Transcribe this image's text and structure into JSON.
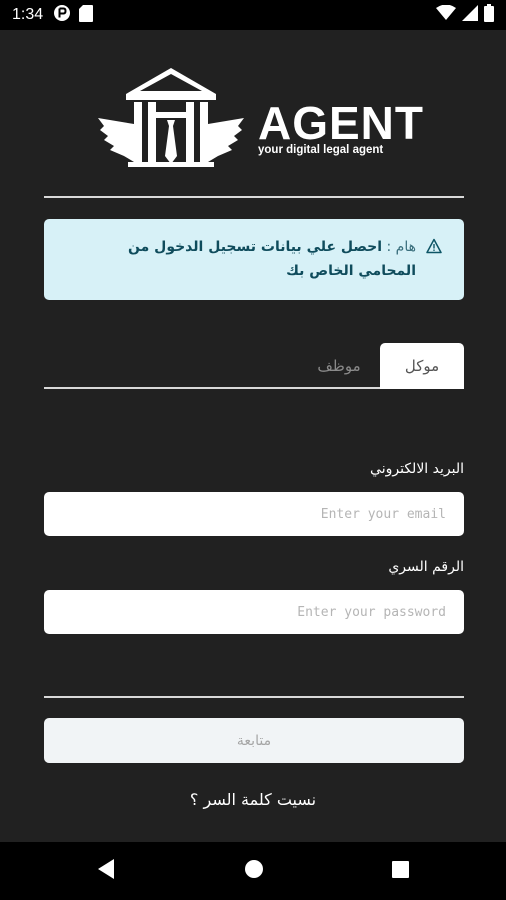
{
  "status_bar": {
    "time": "1:34"
  },
  "logo": {
    "name": "AGENT",
    "tagline": "your digital legal agent"
  },
  "alert": {
    "prefix": "هام :",
    "message": "احصل علي بيانات تسجيل الدخول من المحامي الخاص بك"
  },
  "tabs": [
    {
      "label": "موكل",
      "active": true
    },
    {
      "label": "موظف",
      "active": false
    }
  ],
  "form": {
    "email_label": "البريد الالكتروني",
    "email_placeholder": "Enter your email",
    "email_value": "",
    "password_label": "الرقم السري",
    "password_placeholder": "Enter your password",
    "password_value": "",
    "submit_label": "متابعة",
    "forgot_label": "نسيت كلمة السر ؟"
  },
  "colors": {
    "background": "#212121",
    "alert_bg": "#d7f1f7",
    "alert_text": "#0d5566",
    "status_bar": "#000000"
  },
  "icons": {
    "status_left": [
      "play-store-notification-icon",
      "sd-card-icon"
    ],
    "status_right": [
      "wifi-icon",
      "cellular-signal-icon",
      "battery-icon"
    ],
    "alert": "warning-icon",
    "nav": [
      "back-icon",
      "home-icon",
      "recents-icon"
    ]
  }
}
